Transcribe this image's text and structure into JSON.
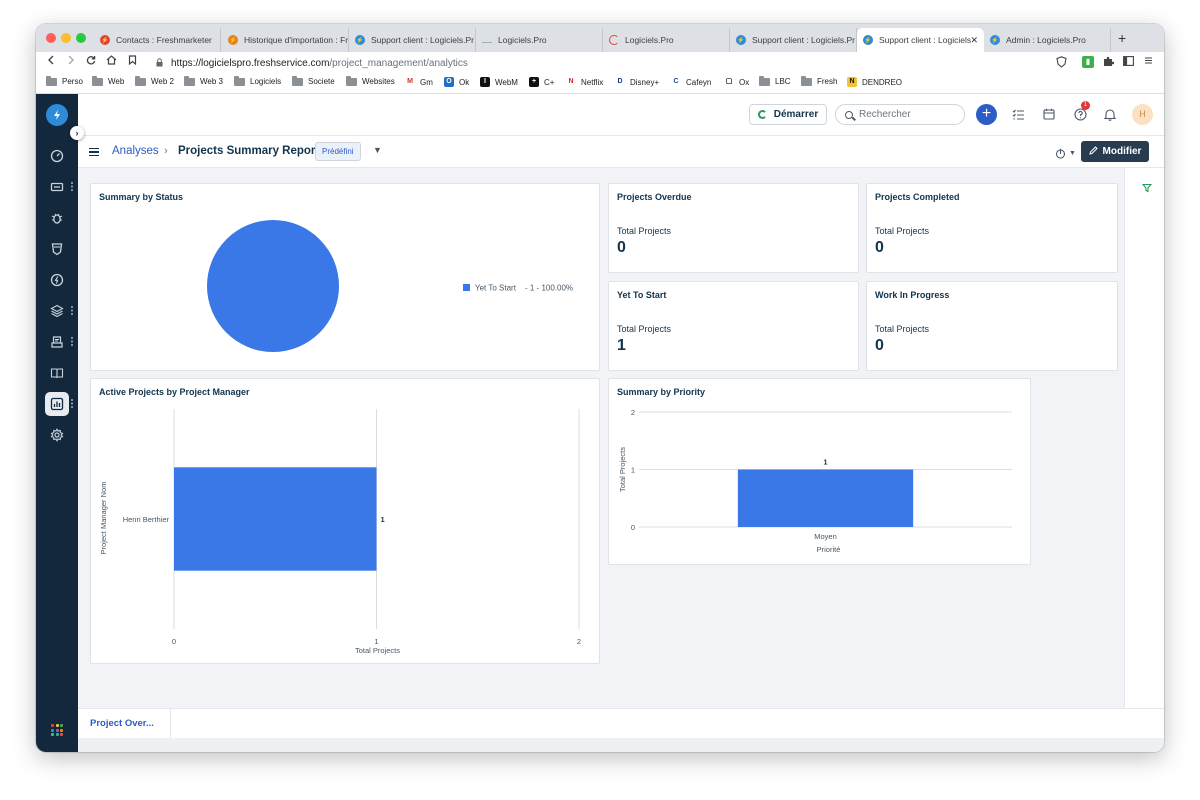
{
  "browser": {
    "tabs": [
      {
        "title": "Contacts : Freshmarketer",
        "favicon": "freshmarketer-icon",
        "color": "#e0433b"
      },
      {
        "title": "Historique d'importation : Fr",
        "favicon": "freshworks-icon",
        "color": "#e8821e"
      },
      {
        "title": "Support client : Logiciels.Pr",
        "favicon": "freshservice-icon",
        "color": "#2e8bd9"
      },
      {
        "title": "Logiciels.Pro",
        "favicon": "page-icon",
        "color": "#a7adb5"
      },
      {
        "title": "Logiciels.Pro",
        "favicon": "loading-icon",
        "color": "#e0433b"
      },
      {
        "title": "Support client : Logiciels.Pr",
        "favicon": "freshservice-icon",
        "color": "#2e8bd9"
      },
      {
        "title": "Support client : Logiciels",
        "favicon": "freshservice-icon",
        "color": "#2e8bd9"
      },
      {
        "title": "Admin : Logiciels.Pro",
        "favicon": "freshservice-icon",
        "color": "#2e8bd9"
      }
    ],
    "active_tab_index": 6,
    "close_label": "✕",
    "new_tab_label": "+",
    "url_host": "https://logicielspro.freshservice.com",
    "url_path": "/project_management/analytics",
    "bookmarks": [
      {
        "label": "Perso",
        "type": "folder"
      },
      {
        "label": "Web",
        "type": "folder"
      },
      {
        "label": "Web 2",
        "type": "folder"
      },
      {
        "label": "Web 3",
        "type": "folder"
      },
      {
        "label": "Logiciels",
        "type": "folder"
      },
      {
        "label": "Societe",
        "type": "folder"
      },
      {
        "label": "Websites",
        "type": "folder"
      },
      {
        "label": "Gm",
        "type": "gmail",
        "fav_text": "M",
        "fav_color": "#ffffff",
        "fav_text_color": "#d93025"
      },
      {
        "label": "Ok",
        "type": "outlook",
        "fav_text": "O",
        "fav_color": "#1f6fc5",
        "fav_text_color": "#ffffff"
      },
      {
        "label": "WebM",
        "type": "webm",
        "fav_text": "I",
        "fav_color": "#111111",
        "fav_text_color": "#ffffff"
      },
      {
        "label": "C+",
        "type": "canal",
        "fav_text": "+",
        "fav_color": "#111111",
        "fav_text_color": "#ffffff"
      },
      {
        "label": "Netflix",
        "type": "netflix",
        "fav_text": "N",
        "fav_color": "#ffffff",
        "fav_text_color": "#d81f26"
      },
      {
        "label": "Disney+",
        "type": "disney",
        "fav_text": "D",
        "fav_color": "#ffffff",
        "fav_text_color": "#1a3a8a"
      },
      {
        "label": "Cafeyn",
        "type": "cafeyn",
        "fav_text": "C",
        "fav_color": "#ffffff",
        "fav_text_color": "#1a4a8a"
      },
      {
        "label": "Ox",
        "type": "ox",
        "fav_text": "▢",
        "fav_color": "#ffffff",
        "fav_text_color": "#111111"
      },
      {
        "label": "LBC",
        "type": "folder"
      },
      {
        "label": "Fresh",
        "type": "folder"
      },
      {
        "label": "DENDREO",
        "type": "dendreo",
        "fav_text": "N",
        "fav_color": "#f2c230",
        "fav_text_color": "#111111"
      }
    ]
  },
  "app": {
    "start_label": "Démarrer",
    "search_placeholder": "Rechercher",
    "notification_count": "1",
    "avatar_initial": "H",
    "breadcrumb_root": "Analyses",
    "breadcrumb_separator": "›",
    "page_title": "Projects Summary Report",
    "chip_label": "Prédéfini",
    "edit_label": "Modifier",
    "bottom_tab": "Project Over...",
    "accent_color": "#2c5cc5",
    "bar_color": "#3b78e7"
  },
  "widgets": {
    "status": {
      "title": "Summary by Status",
      "legend_label": "Yet To Start",
      "legend_value": "- 1 - 100.00%"
    },
    "overdue": {
      "title": "Projects Overdue",
      "label": "Total Projects",
      "value": "0"
    },
    "completed": {
      "title": "Projects Completed",
      "label": "Total Projects",
      "value": "0"
    },
    "yet_to_start": {
      "title": "Yet To Start",
      "label": "Total Projects",
      "value": "1"
    },
    "in_progress": {
      "title": "Work In Progress",
      "label": "Total Projects",
      "value": "0"
    },
    "manager": {
      "title": "Active Projects by Project Manager"
    },
    "priority": {
      "title": "Summary by Priority"
    }
  },
  "chart_data": [
    {
      "type": "pie",
      "title": "Summary by Status",
      "categories": [
        "Yet To Start"
      ],
      "values": [
        1
      ],
      "percentages": [
        100.0
      ],
      "colors": [
        "#3b78e7"
      ],
      "legend_position": "right"
    },
    {
      "type": "bar",
      "orientation": "horizontal",
      "title": "Active Projects by Project Manager",
      "categories": [
        "Henri Berthier"
      ],
      "values": [
        1
      ],
      "data_labels": [
        "1"
      ],
      "xlabel": "Total Projects",
      "ylabel": "Project Manager Nom",
      "xlim": [
        0,
        2
      ],
      "ticks": [
        "0",
        "1",
        "2"
      ],
      "grid": true
    },
    {
      "type": "bar",
      "orientation": "vertical",
      "title": "Summary by Priority",
      "categories": [
        "Moyen"
      ],
      "values": [
        1
      ],
      "data_labels": [
        "1"
      ],
      "xlabel": "Priorité",
      "ylabel": "Total Projects",
      "ylim": [
        0,
        2
      ],
      "ticks": [
        "0",
        "1",
        "2"
      ],
      "grid": true
    }
  ]
}
